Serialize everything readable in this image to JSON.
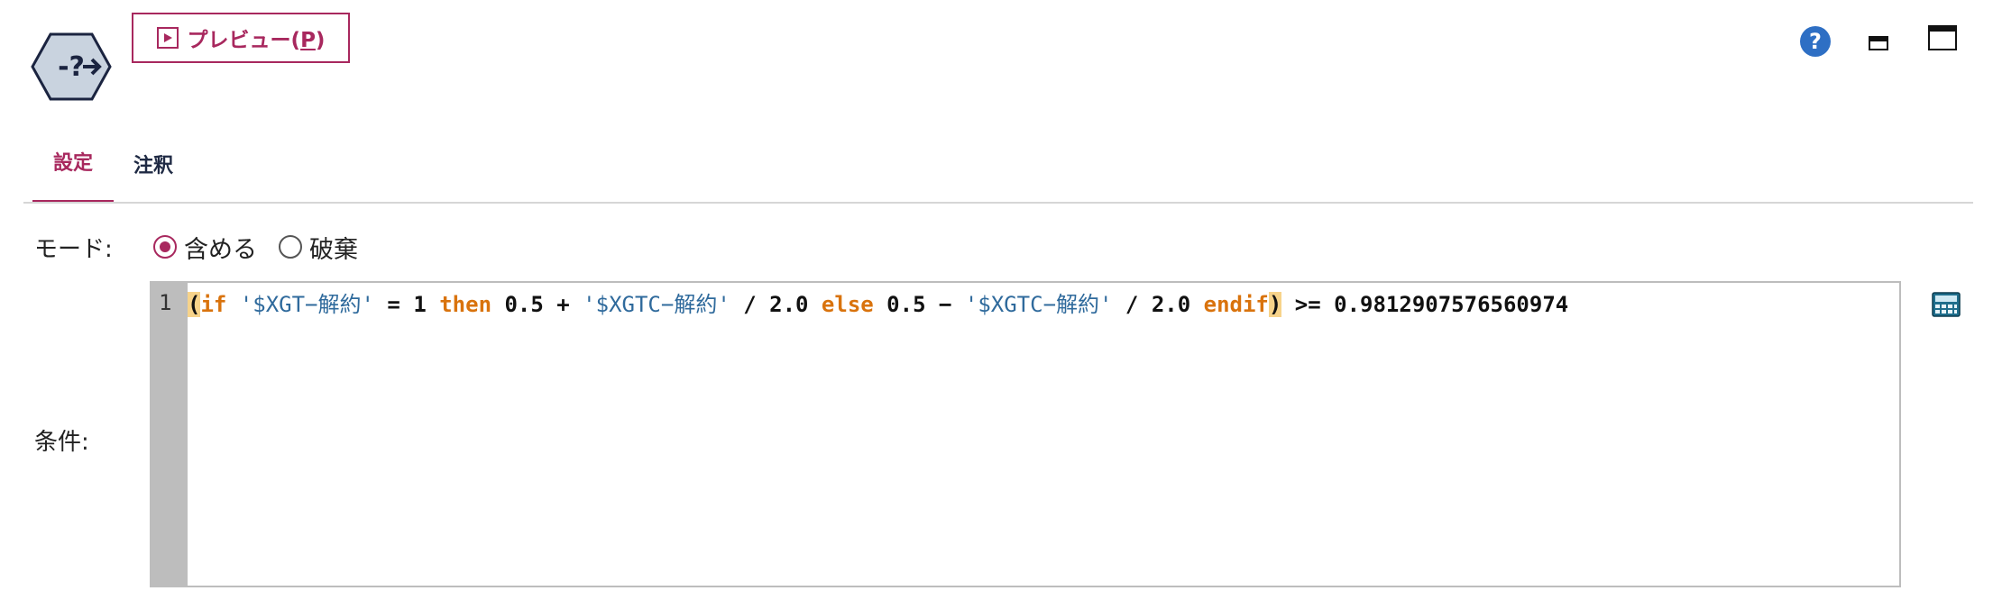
{
  "toolbar": {
    "preview_label": "プレビュー(",
    "preview_mnemonic": "P",
    "preview_close": ")"
  },
  "tabs": [
    {
      "label": "設定",
      "active": true
    },
    {
      "label": "注釈",
      "active": false
    }
  ],
  "mode": {
    "label": "モード:",
    "options": [
      {
        "label": "含める",
        "selected": true
      },
      {
        "label": "破棄",
        "selected": false
      }
    ]
  },
  "condition": {
    "label": "条件:",
    "line_number": "1",
    "tokens": {
      "t1": "(",
      "t2": "if",
      "t3": " ",
      "t4": "'$XGT−解約'",
      "t5": " = 1 ",
      "t6": "then",
      "t7": " 0.5 + ",
      "t8": "'$XGTC−解約'",
      "t9": " / 2.0 ",
      "t10": "else",
      "t11": " 0.5 − ",
      "t12": "'$XGTC−解約'",
      "t13": " / 2.0 ",
      "t14": "endif",
      "t15": ")",
      "t16": " >= 0.9812907576560974"
    }
  },
  "colors": {
    "accent": "#a8285e",
    "keyword": "#d9730d",
    "field": "#2f6a9c",
    "help": "#2e6fc4"
  },
  "icons": {
    "node": "select-node-icon",
    "help": "help-icon",
    "minimize": "minimize-icon",
    "maximize": "maximize-icon",
    "calculator": "expression-builder-icon"
  }
}
